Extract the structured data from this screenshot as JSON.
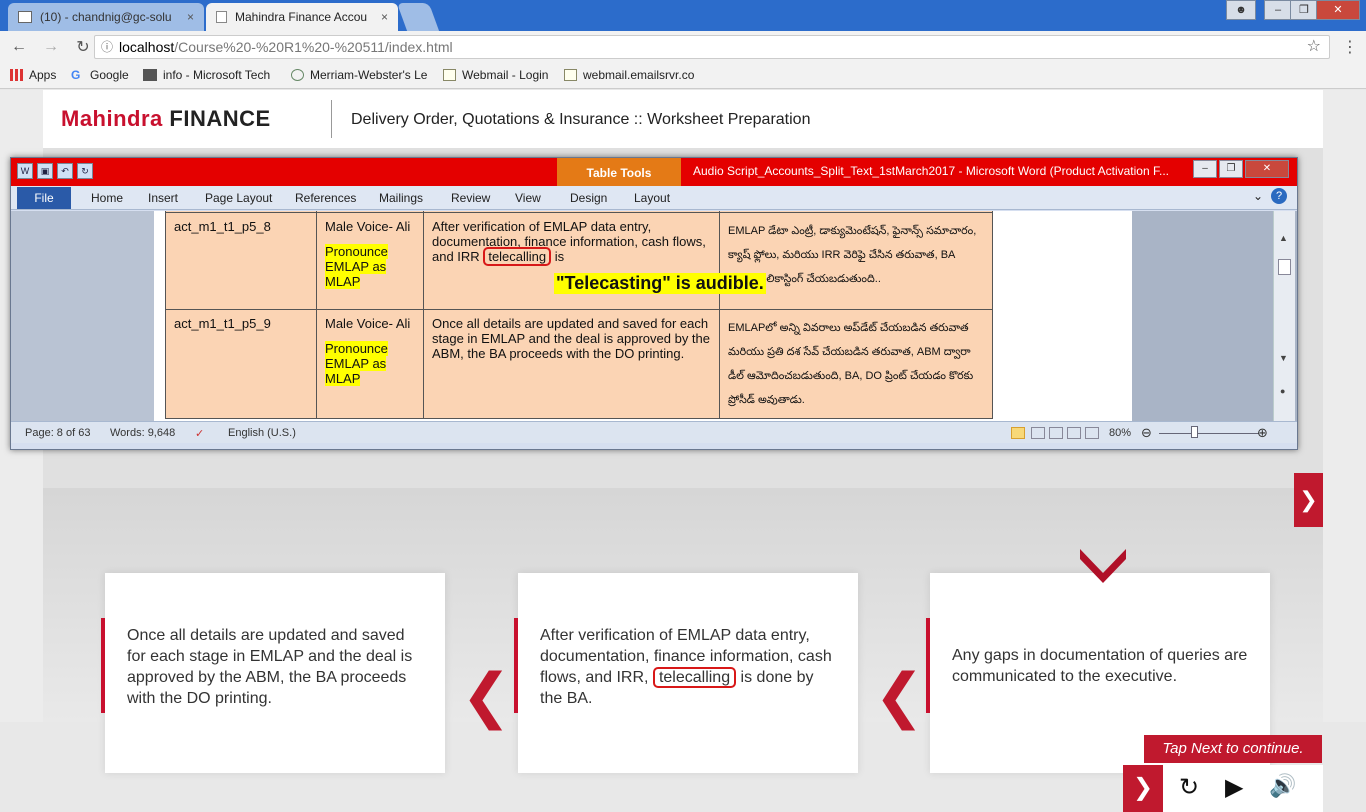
{
  "browser": {
    "tabs": [
      {
        "label": "(10) - chandnig@gc-solu",
        "close": "×"
      },
      {
        "label": "Mahindra Finance Accou",
        "close": "×"
      }
    ],
    "url_host": "localhost",
    "url_path": "/Course%20-%20R1%20-%20511/index.html",
    "bookmarks": [
      "Apps",
      "Google",
      "info - Microsoft Tech",
      "Merriam-Webster's Le",
      "Webmail - Login",
      "webmail.emailsrvr.co"
    ]
  },
  "header": {
    "logo_brand": "Mahindra",
    "logo_finance": "FINANCE",
    "course_title": "Delivery Order, Quotations & Insurance :: Worksheet Preparation"
  },
  "word": {
    "context_tab": "Table Tools",
    "title": "Audio Script_Accounts_Split_Text_1stMarch2017 - Microsoft Word (Product Activation F...",
    "tabs": [
      "File",
      "Home",
      "Insert",
      "Page Layout",
      "References",
      "Mailings",
      "Review",
      "View",
      "Design",
      "Layout"
    ],
    "rows": [
      {
        "id": "act_m1_t1_p5_8",
        "voice": "Male Voice- Ali",
        "pronounce": "Pronounce EMLAP as MLAP",
        "text_before": "After verification of EMLAP data entry, documentation, finance information, cash flows, and IRR",
        "text_word": "telecalling",
        "text_after": "is",
        "telugu": "EMLAP డేటా ఎంట్రీ, డాక్యుమెంటేషన్, ఫైనాన్స్ సమాచారం, క్యాష్ ఫ్లోలు, మరియు IRR వెరిఫై చేసిన తరువాత, BA ద్వారా టెలికాస్టింగ్ చేయబడుతుంది.."
      },
      {
        "id": "act_m1_t1_p5_9",
        "voice": "Male Voice- Ali",
        "pronounce": "Pronounce EMLAP as MLAP",
        "text": "Once all details are updated and saved for each stage in EMLAP and the deal is approved by the ABM, the BA proceeds with the DO printing.",
        "telugu": "EMLAPలో అన్ని వివరాలు అప్‌డేట్ చేయబడిన తరువాత మరియు ప్రతి దశ సేవ్ చేయబడిన తరువాత, ABM ద్వారా డీల్ ఆమోదించబడుతుంది, BA, DO ప్రింట్ చేయడం కొరకు ప్రోసీడ్ అవుతాడు."
      }
    ],
    "annotation": "\"Telecasting\" is audible.",
    "status": {
      "page": "Page: 8 of 63",
      "words": "Words: 9,648",
      "lang": "English (U.S.)",
      "zoom": "80%"
    }
  },
  "slide": {
    "card_left": "Once all details are updated and saved for each stage in EMLAP and the deal is approved by the ABM, the BA proceeds with the DO printing.",
    "card_mid_before": "After verification of EMLAP data entry, documentation, finance information, cash flows, and IRR,",
    "card_mid_word": "telecalling",
    "card_mid_after": "is done by the BA.",
    "card_right": "Any gaps in documentation of queries are communicated to the executive.",
    "tap_next": "Tap Next to continue."
  }
}
